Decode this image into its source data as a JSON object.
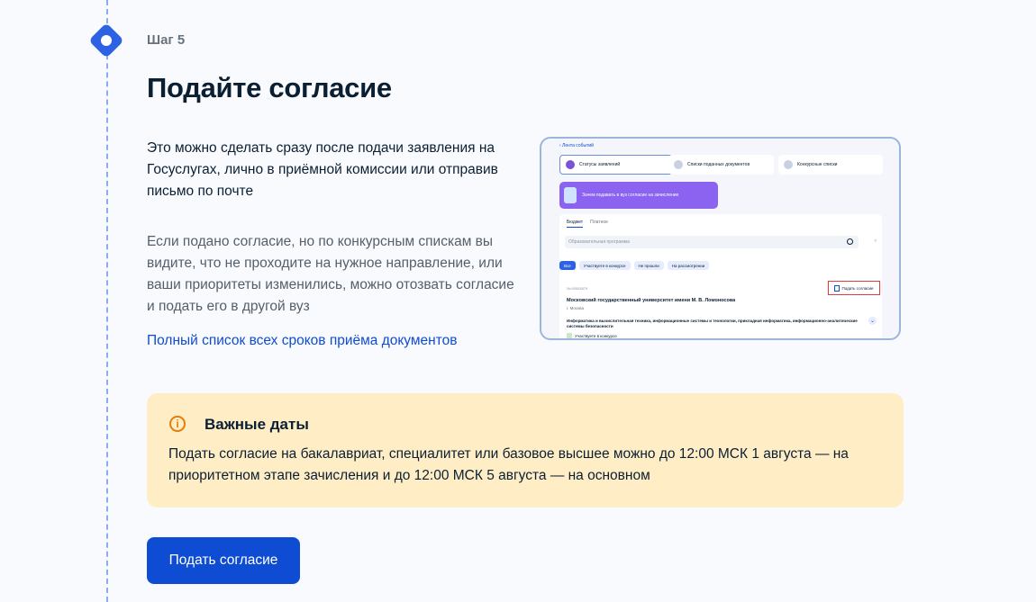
{
  "step": {
    "label": "Шаг 5"
  },
  "title": "Подайте согласие",
  "lead": "Это можно сделать сразу после подачи заявления на Госуслугах, лично в приёмной комиссии или отправив письмо по почте",
  "note": "Если подано согласие, но по конкурсным спискам вы видите, что не проходите на нужное направление, или ваши приоритеты изменились, можно отозвать согласие и подать его в другой вуз",
  "deadlines_link": "Полный список всех сроков приёма документов",
  "preview": {
    "back": "‹ Лента событий",
    "tiles": [
      "Статусы заявлений",
      "Списки поданных документов",
      "Конкурсные списки"
    ],
    "banner": "Зачем подавать в вуз согласие на зачисление",
    "tabs": [
      "Бюджет",
      "Платное"
    ],
    "search_placeholder": "Образовательная программа",
    "chips": [
      "Все",
      "Участвуете в конкурсе",
      "Не прошли",
      "На рассмотрении"
    ],
    "code": "№ 65553879",
    "apply_button": "Подать согласие",
    "university": "Московский государственный университет имени М. В. Ломоносова",
    "city": "г. Москва",
    "program": "Информатика и вычислительная техника, информационные системы и технологии, прикладная информатика, информационно-аналитические системы безопасности",
    "status": "Участвуете в конкурсе"
  },
  "dates": {
    "title": "Важные даты",
    "text": "Подать согласие на бакалавриат, специалитет или базовое высшее можно до 12:00 МСК 1 августа — на приоритетном этапе зачисления и до 12:00 МСК 5 августа — на основном",
    "icon": "info-icon",
    "accent": "#e37e0e",
    "background": "#ffedc6"
  },
  "cta": {
    "label": "Подать согласие",
    "color": "#0d4cd3"
  }
}
